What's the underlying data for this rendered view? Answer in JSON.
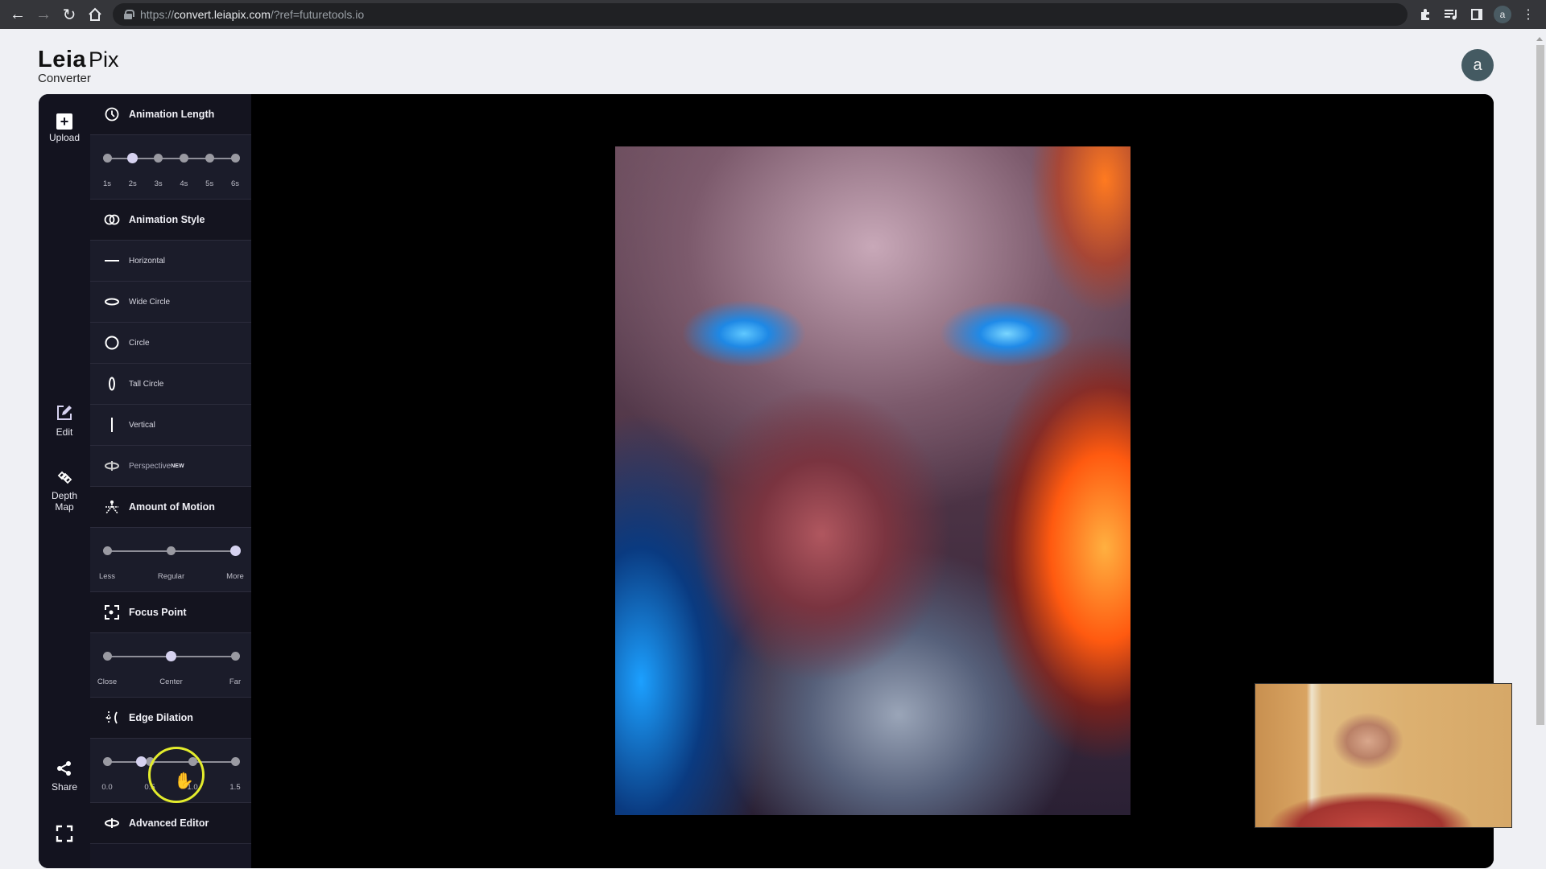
{
  "browser": {
    "url_scheme": "https://",
    "url_host": "convert.leiapix.com",
    "url_path": "/?ref=futuretools.io",
    "profile_initial": "a",
    "icons": [
      "back-icon",
      "forward-icon",
      "reload-icon",
      "home-icon",
      "lock-icon",
      "extensions-icon",
      "media-icon",
      "side-panel-icon",
      "profile-avatar",
      "kebab-menu-icon"
    ]
  },
  "header": {
    "logo_leia": "Leia",
    "logo_pix": "Pix",
    "logo_sub": "Converter",
    "user_initial": "a"
  },
  "toolbar": {
    "upload": "Upload",
    "edit": "Edit",
    "depth_line1": "Depth",
    "depth_line2": "Map",
    "share": "Share"
  },
  "options": {
    "animation_length": {
      "title": "Animation Length",
      "stops": [
        "1s",
        "2s",
        "3s",
        "4s",
        "5s",
        "6s"
      ],
      "selected": "2s"
    },
    "animation_style": {
      "title": "Animation Style",
      "items": [
        {
          "label": "Horizontal",
          "icon": "horizontal-line-icon"
        },
        {
          "label": "Wide Circle",
          "icon": "wide-ellipse-icon"
        },
        {
          "label": "Circle",
          "icon": "circle-icon"
        },
        {
          "label": "Tall Circle",
          "icon": "tall-ellipse-icon"
        },
        {
          "label": "Vertical",
          "icon": "vertical-line-icon"
        },
        {
          "label": "Perspective",
          "icon": "perspective-icon",
          "badge": "NEW"
        }
      ]
    },
    "amount_of_motion": {
      "title": "Amount of Motion",
      "stops": [
        "Less",
        "Regular",
        "More"
      ],
      "selected": "More"
    },
    "focus_point": {
      "title": "Focus Point",
      "stops": [
        "Close",
        "Center",
        "Far"
      ],
      "selected": "Center"
    },
    "edge_dilation": {
      "title": "Edge Dilation",
      "stops": [
        "0.0",
        "0.5",
        "1.0",
        "1.5"
      ],
      "value": 0.4
    },
    "advanced_editor": {
      "title": "Advanced Editor"
    }
  },
  "colors": {
    "accent_thumb": "#d6d2f0",
    "panel": "#161624",
    "avatar": "#445a62",
    "cursor_highlight": "#e3ec2c"
  }
}
